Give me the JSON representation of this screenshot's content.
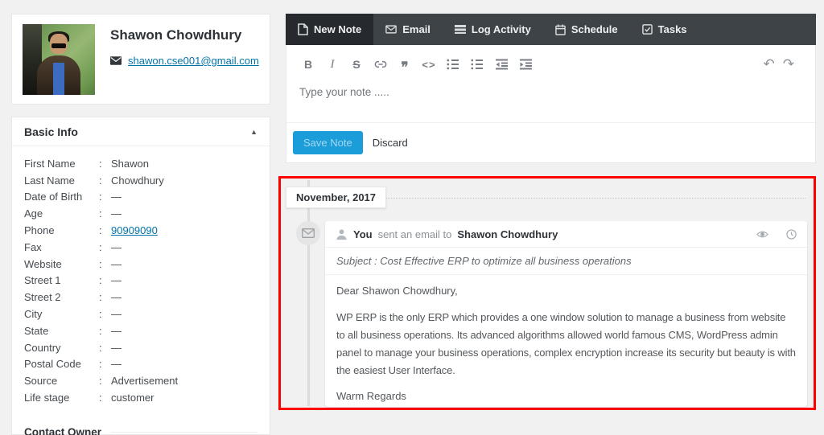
{
  "colors": {
    "accent_blue": "#1a9dd8",
    "link_blue": "#0073aa",
    "highlight_red": "#fd0000",
    "tabbar_bg": "#3e4348",
    "tab_active_bg": "#26292e"
  },
  "profile": {
    "name": "Shawon Chowdhury",
    "email": "shawon.cse001@gmail.com"
  },
  "basic_info": {
    "title": "Basic Info",
    "collapse_arrow": "▲",
    "fields": [
      {
        "label": "First Name",
        "value": "Shawon"
      },
      {
        "label": "Last Name",
        "value": "Chowdhury"
      },
      {
        "label": "Date of Birth",
        "value": "—"
      },
      {
        "label": "Age",
        "value": "—"
      },
      {
        "label": "Phone",
        "value": "90909090",
        "link": true
      },
      {
        "label": "Fax",
        "value": "—"
      },
      {
        "label": "Website",
        "value": "—"
      },
      {
        "label": "Street 1",
        "value": "—"
      },
      {
        "label": "Street 2",
        "value": "—"
      },
      {
        "label": "City",
        "value": "—"
      },
      {
        "label": "State",
        "value": "—"
      },
      {
        "label": "Country",
        "value": "—"
      },
      {
        "label": "Postal Code",
        "value": "—"
      },
      {
        "label": "Source",
        "value": "Advertisement"
      },
      {
        "label": "Life stage",
        "value": "customer"
      }
    ],
    "footer_title": "Contact Owner"
  },
  "tabs": [
    {
      "label": "New Note",
      "icon": "note-icon",
      "active": true
    },
    {
      "label": "Email",
      "icon": "email-icon",
      "active": false
    },
    {
      "label": "Log Activity",
      "icon": "log-icon",
      "active": false
    },
    {
      "label": "Schedule",
      "icon": "calendar-icon",
      "active": false
    },
    {
      "label": "Tasks",
      "icon": "tasks-icon",
      "active": false
    }
  ],
  "editor": {
    "toolbar": [
      "bold",
      "italic",
      "strikethrough",
      "link",
      "blockquote",
      "code",
      "bullet-list",
      "ordered-list",
      "outdent",
      "indent"
    ],
    "history": [
      {
        "name": "undo",
        "glyph": "↶"
      },
      {
        "name": "redo",
        "glyph": "↷"
      }
    ],
    "placeholder": "Type your note .....",
    "save_label": "Save Note",
    "discard_label": "Discard"
  },
  "timeline": {
    "month_label": "November, 2017",
    "entry": {
      "actor": "You",
      "action": "sent an email to",
      "target": "Shawon Chowdhury",
      "subject": "Subject : Cost Effective ERP to optimize all business operations",
      "greeting": "Dear Shawon Chowdhury,",
      "body": "WP ERP is the only ERP which provides a one window solution to manage a business from website to all business operations. Its advanced algorithms allowed world famous CMS, WordPress admin panel to manage your business operations, complex encryption increase its security but beauty is with the easiest User Interface.",
      "signoff": "Warm Regards"
    }
  }
}
